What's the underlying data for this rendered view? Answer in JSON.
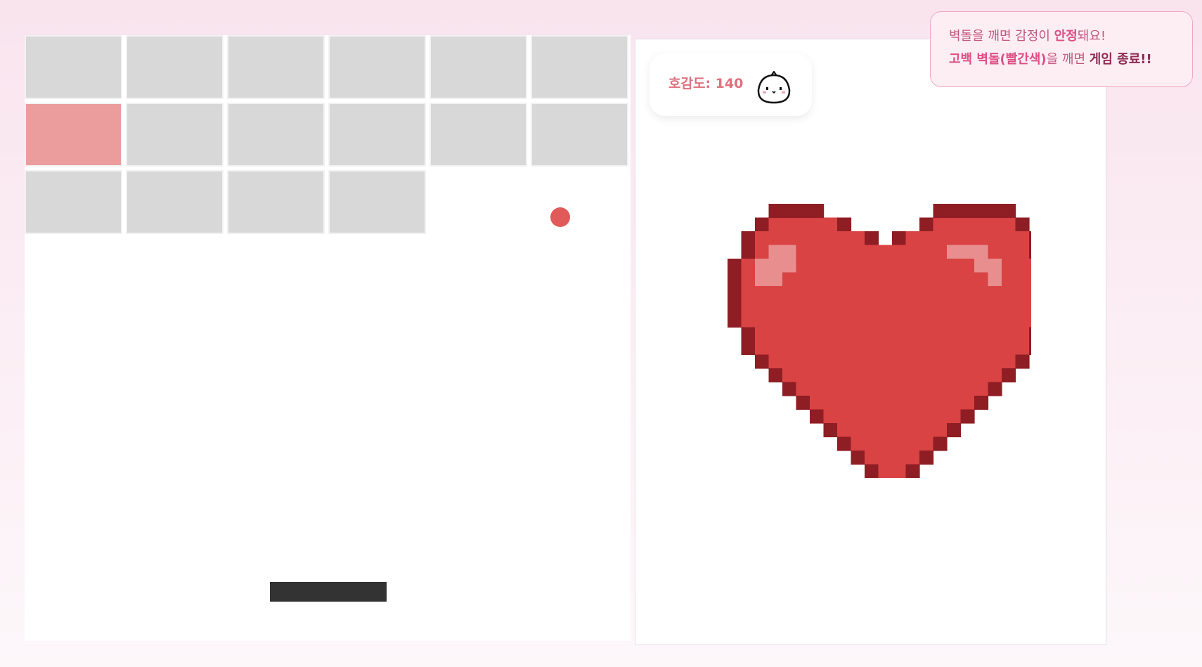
{
  "colors": {
    "brick_default": "#d9d8d9",
    "brick_confession": "#eb9d9e",
    "ball": "#e05a59",
    "paddle": "#333333",
    "heart_fill": "#d94343",
    "heart_outline": "#8e1e24"
  },
  "game": {
    "bricks": [
      {
        "type": "normal"
      },
      {
        "type": "normal"
      },
      {
        "type": "normal"
      },
      {
        "type": "normal"
      },
      {
        "type": "normal"
      },
      {
        "type": "normal"
      },
      {
        "type": "confession"
      },
      {
        "type": "normal"
      },
      {
        "type": "normal"
      },
      {
        "type": "normal"
      },
      {
        "type": "normal"
      },
      {
        "type": "normal"
      },
      {
        "type": "normal"
      },
      {
        "type": "normal"
      },
      {
        "type": "normal"
      },
      {
        "type": "normal"
      }
    ]
  },
  "score": {
    "label": "호감도: 140",
    "mascot_icon": "bun-mascot-icon"
  },
  "heart": {
    "icon": "pixel-heart-icon"
  },
  "tip": {
    "line1_pre": "벽돌을 깨면 감정이 ",
    "line1_bold": "안정",
    "line1_post": "돼요!",
    "line2_bold1": "고백 벽돌(빨간색)",
    "line2_mid": "을 깨면 ",
    "line2_bold2": "게임 종료!!"
  }
}
